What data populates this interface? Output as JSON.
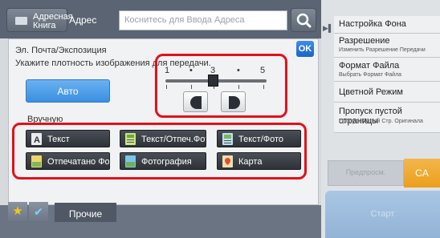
{
  "header": {
    "address_book_label": "Адресная Книга",
    "address_label": "Адрес",
    "address_placeholder": "Коснитесь для Ввода Адреса",
    "search_icon": "search-icon"
  },
  "dialog": {
    "title": "Эл. Почта/Экспозиция",
    "subtitle": "Укажите плотность изображения для передачи.",
    "ok_label": "OK",
    "auto_label": "Авто",
    "manual_label": "Вручную",
    "exposure": {
      "tick_labels": [
        "1",
        "•",
        "3",
        "•",
        "5"
      ],
      "value": 3,
      "min": 1,
      "max": 5
    },
    "image_types": [
      {
        "label": "Текст",
        "icon": "text-doc-icon"
      },
      {
        "label": "Текст/Отпеч.Фото",
        "icon": "text-printed-photo-icon"
      },
      {
        "label": "Текст/Фото",
        "icon": "text-photo-icon"
      },
      {
        "label": "Отпечатано Фото",
        "icon": "printed-photo-icon"
      },
      {
        "label": "Фотография",
        "icon": "photo-icon"
      },
      {
        "label": "Карта",
        "icon": "map-icon"
      }
    ]
  },
  "right_panel": {
    "items": [
      {
        "main": "Настройка Фона",
        "sub": ""
      },
      {
        "main": "Разрешение",
        "sub": "Изменить Разрешение Передачи"
      },
      {
        "main": "Формат Файла",
        "sub": "Выбрать Формат Файла"
      },
      {
        "main": "Цветной Режим",
        "sub": ""
      },
      {
        "main": "Пропуск пустой страницы",
        "sub": "Пропуск Пустой Стр. Оригинала"
      }
    ],
    "preview_label": "Предпросм.",
    "ca_label": "CA",
    "start_label": "Старт"
  },
  "footer": {
    "other_label": "Прочие"
  },
  "colors": {
    "accent_blue": "#3a8fe1",
    "highlight_red": "#e3101a",
    "ca_orange": "#ec9f1c"
  }
}
